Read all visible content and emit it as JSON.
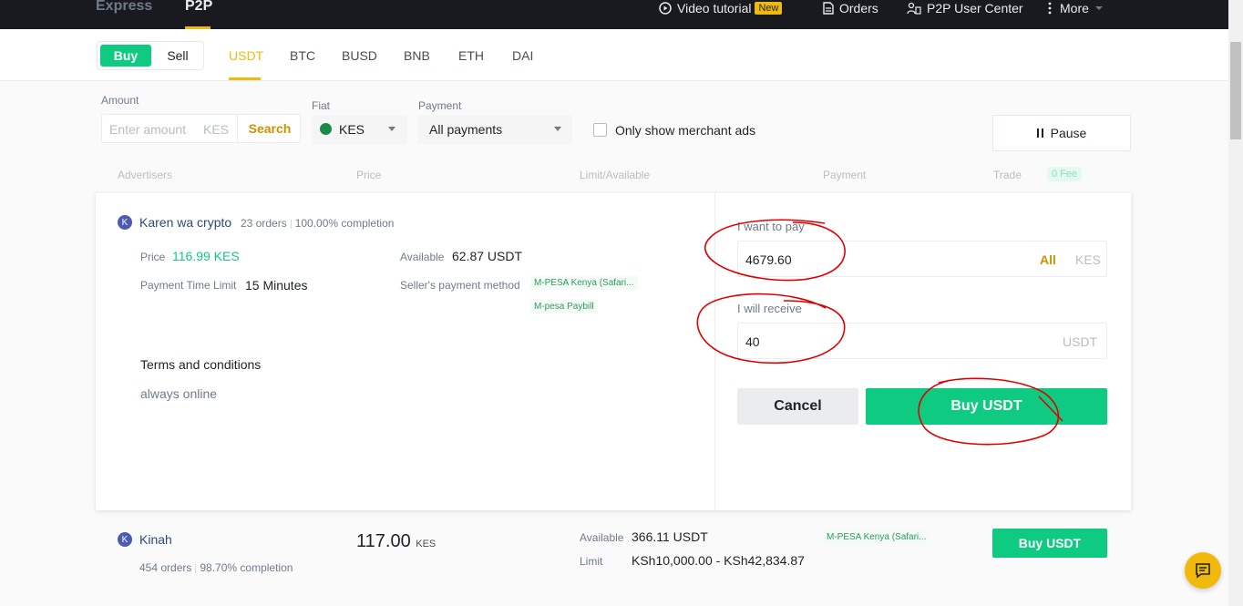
{
  "nav": {
    "express": "Express",
    "p2p": "P2P",
    "video_tutorial": "Video tutorial",
    "new_badge": "New",
    "orders": "Orders",
    "user_center": "P2P User Center",
    "more": "More"
  },
  "trade_toggle": {
    "buy": "Buy",
    "sell": "Sell"
  },
  "coins": [
    "USDT",
    "BTC",
    "BUSD",
    "BNB",
    "ETH",
    "DAI"
  ],
  "filters": {
    "amount_label": "Amount",
    "amount_placeholder": "Enter amount",
    "amount_unit": "KES",
    "search": "Search",
    "fiat_label": "Fiat",
    "fiat_value": "KES",
    "payment_label": "Payment",
    "payment_value": "All payments",
    "merchant_only": "Only show merchant ads",
    "pause": "Pause"
  },
  "table_header": {
    "advertisers": "Advertisers",
    "price": "Price",
    "limit": "Limit/Available",
    "payment": "Payment",
    "trade": "Trade",
    "fee": "0 Fee"
  },
  "ad1": {
    "avatar": "K",
    "name": "Karen wa crypto",
    "orders": "23 orders",
    "completion": "100.00% completion",
    "price_label": "Price",
    "price": "116.99 KES",
    "available_label": "Available",
    "available": "62.87 USDT",
    "time_limit_label": "Payment Time Limit",
    "time_limit": "15 Minutes",
    "seller_method_label": "Seller's payment method",
    "method1": "M-PESA Kenya (Safari...",
    "method2": "M-pesa Paybill",
    "terms_title": "Terms and conditions",
    "terms_text": "always online",
    "pay_label": "I want to pay",
    "pay_value": "4679.60",
    "pay_all": "All",
    "pay_unit": "KES",
    "receive_label": "I will receive",
    "receive_value": "40",
    "receive_unit": "USDT",
    "cancel": "Cancel",
    "buy": "Buy USDT"
  },
  "ad2": {
    "avatar": "K",
    "name": "Kinah",
    "orders": "454 orders",
    "completion": "98.70% completion",
    "price": "117.00",
    "price_unit": "KES",
    "available_label": "Available",
    "available": "366.11 USDT",
    "limit_label": "Limit",
    "limit": "KSh10,000.00 - KSh42,834.87",
    "method": "M-PESA Kenya (Safari...",
    "buy": "Buy USDT"
  },
  "colors": {
    "accent": "#f0b90b",
    "buy_green": "#0ecb81",
    "nav_bg": "#181a20",
    "annotation_red": "#e00000"
  }
}
